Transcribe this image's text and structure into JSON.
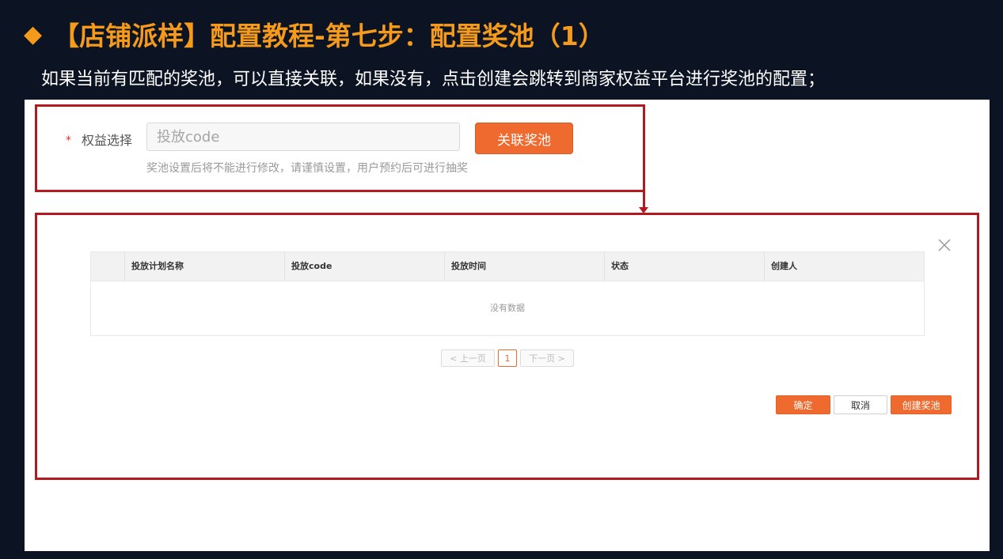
{
  "slide": {
    "title": "【店铺派样】配置教程-第七步：配置奖池（1）",
    "subtitle": "如果当前有匹配的奖池，可以直接关联，如果没有，点击创建会跳转到商家权益平台进行奖池的配置；"
  },
  "form": {
    "required_mark": "*",
    "label": "权益选择",
    "input_placeholder": "投放code",
    "input_value": "",
    "link_button": "关联奖池",
    "hint": "奖池设置后将不能进行修改，请谨慎设置，用户预约后可进行抽奖"
  },
  "modal": {
    "table": {
      "columns": [
        "投放计划名称",
        "投放code",
        "投放时间",
        "状态",
        "创建人"
      ],
      "empty_text": "没有数据"
    },
    "pagination": {
      "prev": "< 上一页",
      "current": "1",
      "next": "下一页 >"
    },
    "buttons": {
      "confirm": "确定",
      "cancel": "取消",
      "create": "创建奖池"
    }
  },
  "colors": {
    "slide_background": "#0c1424",
    "title_orange": "#f59a1a",
    "frame_red": "#b3191f",
    "accent_orange": "#ef6a2e"
  },
  "icons": [
    "diamond-bullet-icon",
    "close-icon",
    "connector-arrow-icon"
  ]
}
